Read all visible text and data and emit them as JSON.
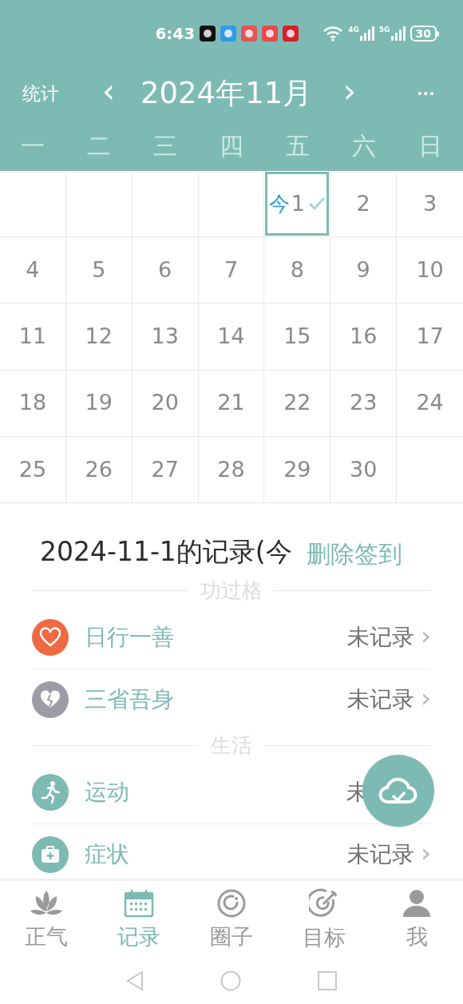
{
  "status_bar": {
    "time": "6:43",
    "net_1": "4G",
    "net_2": "5G",
    "battery": "30"
  },
  "header": {
    "left": "统计",
    "prev": "‹",
    "title": "2024年11月",
    "next": "›",
    "more": "···"
  },
  "weekdays": [
    "一",
    "二",
    "三",
    "四",
    "五",
    "六",
    "日"
  ],
  "calendar": {
    "weeks": [
      [
        {
          "kind": "blank"
        },
        {
          "kind": "blank"
        },
        {
          "kind": "blank"
        },
        {
          "kind": "blank"
        },
        {
          "kind": "day",
          "day": "1",
          "today_label": "今",
          "selected": true,
          "checked": true
        },
        {
          "kind": "day",
          "day": "2",
          "selected": false,
          "checked": false
        },
        {
          "kind": "day",
          "day": "3",
          "selected": false,
          "checked": false
        }
      ],
      [
        {
          "kind": "day",
          "day": "4",
          "selected": false,
          "checked": false
        },
        {
          "kind": "day",
          "day": "5",
          "selected": false,
          "checked": false
        },
        {
          "kind": "day",
          "day": "6",
          "selected": false,
          "checked": false
        },
        {
          "kind": "day",
          "day": "7",
          "selected": false,
          "checked": false
        },
        {
          "kind": "day",
          "day": "8",
          "selected": false,
          "checked": false
        },
        {
          "kind": "day",
          "day": "9",
          "selected": false,
          "checked": false
        },
        {
          "kind": "day",
          "day": "10",
          "selected": false,
          "checked": false
        }
      ],
      [
        {
          "kind": "day",
          "day": "11",
          "selected": false,
          "checked": false
        },
        {
          "kind": "day",
          "day": "12",
          "selected": false,
          "checked": false
        },
        {
          "kind": "day",
          "day": "13",
          "selected": false,
          "checked": false
        },
        {
          "kind": "day",
          "day": "14",
          "selected": false,
          "checked": false
        },
        {
          "kind": "day",
          "day": "15",
          "selected": false,
          "checked": false
        },
        {
          "kind": "day",
          "day": "16",
          "selected": false,
          "checked": false
        },
        {
          "kind": "day",
          "day": "17",
          "selected": false,
          "checked": false
        }
      ],
      [
        {
          "kind": "day",
          "day": "18",
          "selected": false,
          "checked": false
        },
        {
          "kind": "day",
          "day": "19",
          "selected": false,
          "checked": false
        },
        {
          "kind": "day",
          "day": "20",
          "selected": false,
          "checked": false
        },
        {
          "kind": "day",
          "day": "21",
          "selected": false,
          "checked": false
        },
        {
          "kind": "day",
          "day": "22",
          "selected": false,
          "checked": false
        },
        {
          "kind": "day",
          "day": "23",
          "selected": false,
          "checked": false
        },
        {
          "kind": "day",
          "day": "24",
          "selected": false,
          "checked": false
        }
      ],
      [
        {
          "kind": "day",
          "day": "25",
          "selected": false,
          "checked": false
        },
        {
          "kind": "day",
          "day": "26",
          "selected": false,
          "checked": false
        },
        {
          "kind": "day",
          "day": "27",
          "selected": false,
          "checked": false
        },
        {
          "kind": "day",
          "day": "28",
          "selected": false,
          "checked": false
        },
        {
          "kind": "day",
          "day": "29",
          "selected": false,
          "checked": false
        },
        {
          "kind": "day",
          "day": "30",
          "selected": false,
          "checked": false
        },
        {
          "kind": "blank"
        }
      ]
    ]
  },
  "record": {
    "title": "2024-11-1的记录(今",
    "delete_button": "删除签到"
  },
  "sections": [
    {
      "title": "功过格",
      "items": [
        {
          "kind": "heart",
          "color": "#ef6a43",
          "label": "日行一善",
          "status": "未记录",
          "chevron": "›"
        },
        {
          "kind": "broken-heart",
          "color": "#9d9ba6",
          "label": "三省吾身",
          "status": "未记录",
          "chevron": "›"
        }
      ]
    },
    {
      "title": "生活",
      "items": [
        {
          "kind": "runner",
          "color": "#7dbab3",
          "label": "运动",
          "status": "未"
        },
        {
          "kind": "medkit",
          "color": "#7dbab3",
          "label": "症状",
          "status": "未记录",
          "chevron": "›"
        }
      ]
    }
  ],
  "bottom_nav": [
    {
      "kind": "lotus",
      "label": "正气",
      "selected": false
    },
    {
      "kind": "calendar",
      "label": "记录",
      "selected": true
    },
    {
      "kind": "circle",
      "label": "圈子",
      "selected": false
    },
    {
      "kind": "target",
      "label": "目标",
      "selected": false
    },
    {
      "kind": "person",
      "label": "我",
      "selected": false
    }
  ]
}
